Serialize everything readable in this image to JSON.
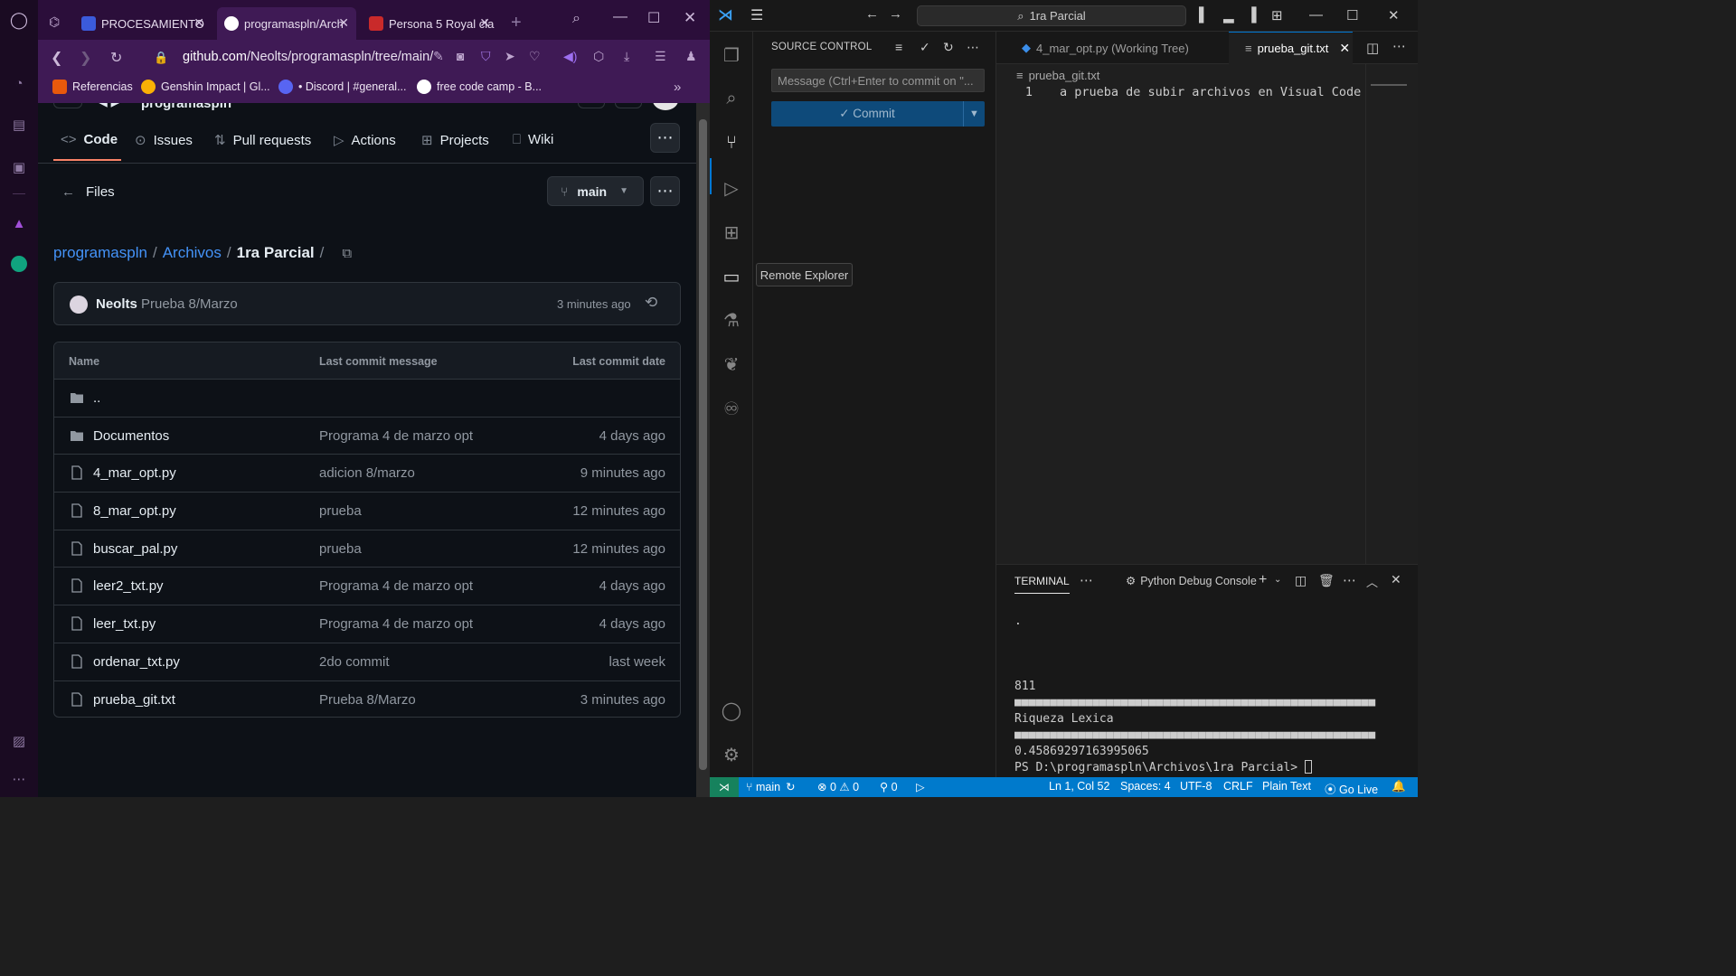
{
  "browser": {
    "tabs": [
      {
        "title": "PROCESAMIENTO",
        "favicon_color": "#3b5bdb"
      },
      {
        "title": "programaspln/Arch",
        "favicon_color": "#ffffff"
      },
      {
        "title": "Persona 5 Royal cla",
        "favicon_color": "#c92a2a"
      }
    ],
    "url_domain": "github.com",
    "url_path": "/Neolts/programaspln/tree/main/",
    "bookmarks": [
      {
        "label": "Referencias",
        "color": "#e8590c"
      },
      {
        "label": "Genshin Impact | Gl...",
        "color": "#fab005"
      },
      {
        "label": "• Discord | #general...",
        "color": "#5865f2"
      },
      {
        "label": "free code camp - B...",
        "color": "#ffffff"
      }
    ]
  },
  "github": {
    "repo_title": "programaspln",
    "nav_tabs": [
      {
        "label": "Code",
        "icon": "code-icon"
      },
      {
        "label": "Issues",
        "icon": "issue-icon"
      },
      {
        "label": "Pull requests",
        "icon": "pull-request-icon"
      },
      {
        "label": "Actions",
        "icon": "play-icon"
      },
      {
        "label": "Projects",
        "icon": "table-icon"
      },
      {
        "label": "Wiki",
        "icon": "book-icon"
      }
    ],
    "files_label": "Files",
    "branch": "main",
    "breadcrumb": {
      "root": "programaspln",
      "folder": "Archivos",
      "current": "1ra Parcial"
    },
    "latest_commit": {
      "author": "Neolts",
      "message": "Prueba 8/Marzo",
      "time": "3 minutes ago"
    },
    "table_headers": {
      "name": "Name",
      "message": "Last commit message",
      "date": "Last commit date"
    },
    "parent_dir": "..",
    "rows": [
      {
        "name": "Documentos",
        "type": "folder",
        "message": "Programa 4 de marzo opt",
        "date": "4 days ago"
      },
      {
        "name": "4_mar_opt.py",
        "type": "file",
        "message": "adicion 8/marzo",
        "date": "9 minutes ago"
      },
      {
        "name": "8_mar_opt.py",
        "type": "file",
        "message": "prueba",
        "date": "12 minutes ago"
      },
      {
        "name": "buscar_pal.py",
        "type": "file",
        "message": "prueba",
        "date": "12 minutes ago"
      },
      {
        "name": "leer2_txt.py",
        "type": "file",
        "message": "Programa 4 de marzo opt",
        "date": "4 days ago"
      },
      {
        "name": "leer_txt.py",
        "type": "file",
        "message": "Programa 4 de marzo opt",
        "date": "4 days ago"
      },
      {
        "name": "ordenar_txt.py",
        "type": "file",
        "message": "2do commit",
        "date": "last week"
      },
      {
        "name": "prueba_git.txt",
        "type": "file",
        "message": "Prueba 8/Marzo",
        "date": "3 minutes ago"
      }
    ]
  },
  "vscode": {
    "search_text": "1ra Parcial",
    "sidebar_title": "SOURCE CONTROL",
    "commit_placeholder": "Message (Ctrl+Enter to commit on \"...",
    "commit_label": "✓ Commit",
    "tooltip": "Remote Explorer",
    "editor_tabs": [
      {
        "label": "4_mar_opt.py (Working Tree)",
        "active": false
      },
      {
        "label": "prueba_git.txt",
        "active": true
      }
    ],
    "editor_breadcrumb": "prueba_git.txt",
    "line_number": "1",
    "line_text": "a prueba de subir archivos en Visual Code",
    "terminal_tab": "TERMINAL",
    "terminal_console": "Python Debug Console",
    "terminal_lines": [
      ".",
      "",
      "",
      "",
      "811",
      "■■■■■■■■■■■■■■■■■■■■■■■■■■■■■■■■■■■■■■■■■■■■■■■■■■■",
      "Riqueza Lexica",
      "■■■■■■■■■■■■■■■■■■■■■■■■■■■■■■■■■■■■■■■■■■■■■■■■■■■",
      "0.45869297163995065",
      "PS D:\\programaspln\\Archivos\\1ra Parcial> "
    ],
    "status": {
      "branch": "main",
      "errors": "0",
      "warnings": "0",
      "ports": "0",
      "cursor": "Ln 1, Col 52",
      "spaces": "Spaces: 4",
      "encoding": "UTF-8",
      "eol": "CRLF",
      "language": "Plain Text",
      "golive": "Go Live"
    },
    "accent": "#007acc"
  }
}
